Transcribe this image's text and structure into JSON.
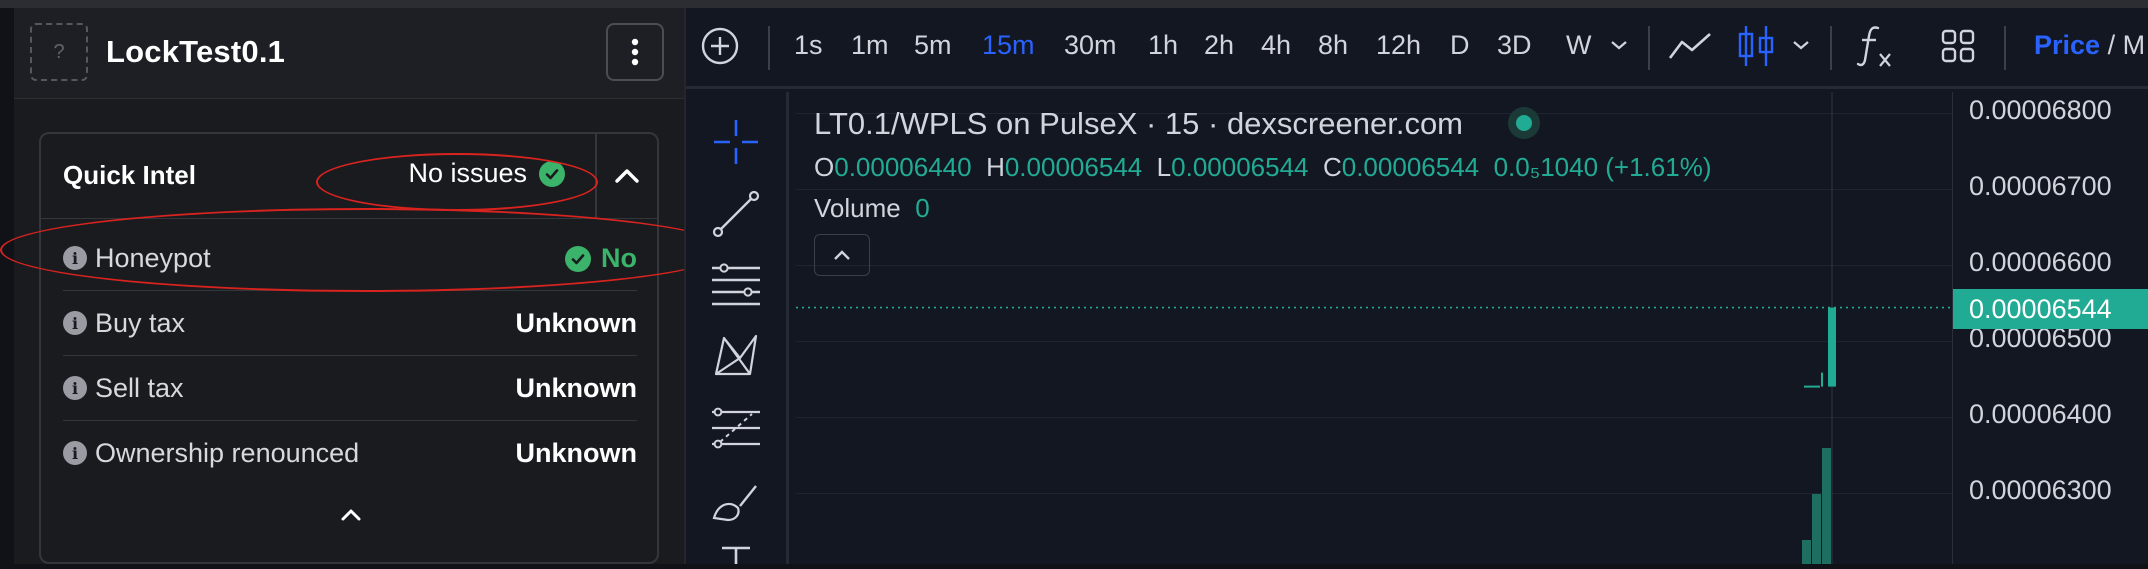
{
  "token_panel": {
    "avatar_placeholder": "?",
    "token_name": "LockTest0.1",
    "quick_intel": {
      "title": "Quick Intel",
      "status_text": "No issues",
      "rows": [
        {
          "label": "Honeypot",
          "value": "No"
        },
        {
          "label": "Buy tax",
          "value": "Unknown"
        },
        {
          "label": "Sell tax",
          "value": "Unknown"
        },
        {
          "label": "Ownership renounced",
          "value": "Unknown"
        }
      ]
    }
  },
  "toolbar": {
    "intervals": [
      "1s",
      "1m",
      "5m",
      "15m",
      "30m",
      "1h",
      "2h",
      "4h",
      "8h",
      "12h",
      "D",
      "3D",
      "W"
    ],
    "active_interval": "15m",
    "price_label": "Price",
    "price_suffix": "/ M"
  },
  "chart_legend": {
    "title": "LT0.1/WPLS on PulseX · 15 · dexscreener.com",
    "ohlc": {
      "o_label": "O",
      "o": "0.00006440",
      "h_label": "H",
      "h": "0.00006544",
      "l_label": "L",
      "l": "0.00006544",
      "c_label": "C",
      "c": "0.00006544",
      "change": "0.0₅1040 (+1.61%)"
    },
    "volume_label": "Volume",
    "volume_value": "0"
  },
  "price_axis": {
    "ticks": [
      "0.00006800",
      "0.00006700",
      "0.00006600",
      "0.00006500",
      "0.00006400",
      "0.00006300"
    ],
    "current_price": "0.00006544"
  },
  "colors": {
    "accent_blue": "#2962ff",
    "up_green": "#22ab94",
    "ok_green": "#3bb36a",
    "annotation_red": "#d8231f"
  },
  "icons": [
    "question-icon",
    "kebab-menu-icon",
    "check-circle-icon",
    "chevron-up-icon",
    "info-icon",
    "plus-circle-icon",
    "chevron-down-icon",
    "line-chart-icon",
    "candles-icon",
    "function-icon",
    "layout-grid-icon",
    "crosshair-icon",
    "trend-line-icon",
    "horizontal-lines-icon",
    "pattern-icon",
    "fib-icon",
    "brush-icon",
    "text-icon"
  ],
  "chart_data": {
    "type": "candlestick",
    "title": "LT0.1/WPLS on PulseX · 15 · dexscreener.com",
    "ylim": [
      6.24e-05,
      6.83e-05
    ],
    "last_candle": {
      "open": 6.44e-05,
      "high": 6.544e-05,
      "low": 6.544e-05,
      "close": 6.544e-05
    },
    "current_price": 6.544e-05,
    "volume": 0
  }
}
